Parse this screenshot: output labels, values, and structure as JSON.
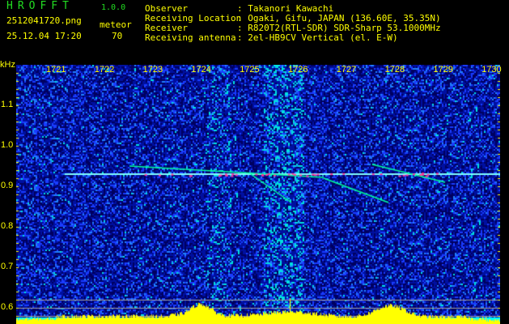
{
  "header": {
    "app_title": "HROFFT",
    "version": "1.0.0",
    "filename": "2512041720.png",
    "meteor_label": "meteor",
    "datetime": "25.12.04 17:20",
    "meteor_count": "70"
  },
  "info": [
    {
      "key": "Observer",
      "value": ": Takanori Kawachi"
    },
    {
      "key": "Receiving Location",
      "value": ": Ogaki, Gifu, JAPAN (136.60E, 35.35N)"
    },
    {
      "key": "Receiver",
      "value": ": R820T2(RTL-SDR) SDR-Sharp 53.1000MHz"
    },
    {
      "key": "Receiving antenna",
      "value": ": 2el-HB9CV Vertical (el. E-W)"
    }
  ],
  "spectrogram": {
    "y_unit": "kHz",
    "y_ticks": [
      "1.1",
      "1.0",
      "0.9",
      "0.8",
      "0.7",
      "0.6"
    ],
    "x_ticks": [
      "1721",
      "1722",
      "1723",
      "1724",
      "1725",
      "1726",
      "1727",
      "1728",
      "1729",
      "1730"
    ],
    "y_range_khz": [
      0.56,
      1.2
    ],
    "carrier_khz": 0.93,
    "colors": {
      "background": "#000080",
      "noise": "#1a3cff",
      "signal": "#00ffff",
      "peak": "#ff3399",
      "profile": "#ffff00",
      "baseline": "#00ffff"
    }
  }
}
